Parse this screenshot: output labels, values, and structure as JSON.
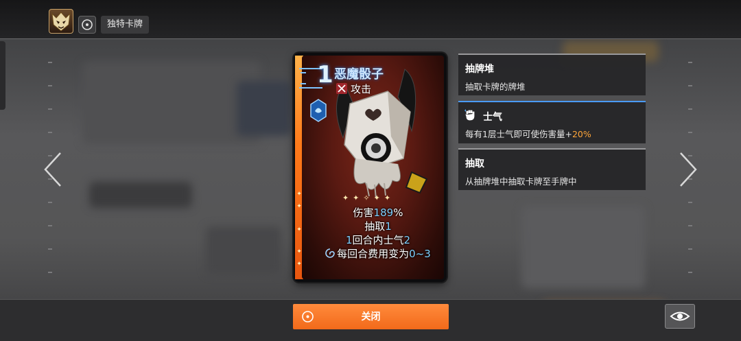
{
  "header": {
    "hero_icon": "demon-mask-icon",
    "target_icon": "target-icon",
    "title": "独特卡牌"
  },
  "card": {
    "cost": "1",
    "name": "恶魔骰子",
    "type_icon": "crossed-swords-icon",
    "type": "攻击",
    "rarity_icon": "dice-emblem-icon",
    "art": "demon-dice-creature",
    "effects": [
      {
        "prefix": "伤害",
        "value": "189",
        "suffix": "%"
      },
      {
        "prefix": "抽取",
        "value": "1",
        "suffix": ""
      },
      {
        "prefix": "",
        "value": "1",
        "suffix": "回合内士气",
        "value2": "2"
      },
      {
        "icon": "cost-swirl-icon",
        "prefix": "每回合费用变为",
        "value": "0~3",
        "suffix": ""
      }
    ]
  },
  "tooltips": [
    {
      "title": "抽牌堆",
      "desc": "抽取卡牌的牌堆"
    },
    {
      "icon": "raised-fist-icon",
      "title": "士气",
      "desc_prefix": "每有1层士气即可使伤害量+",
      "desc_value": "20%"
    },
    {
      "title": "抽取",
      "desc": "从抽牌堆中抽取卡牌至手牌中"
    }
  ],
  "footer": {
    "close_label": "关闭",
    "close_icon": "target-icon",
    "view_icon": "eye-icon"
  },
  "nav": {
    "prev_icon": "chevron-left-icon",
    "next_icon": "chevron-right-icon"
  },
  "colors": {
    "accent_orange": "#f26a1a",
    "highlight_blue": "#7fd0ff",
    "highlight_orange": "#ffa63a",
    "card_bg": "#5a1a12"
  }
}
